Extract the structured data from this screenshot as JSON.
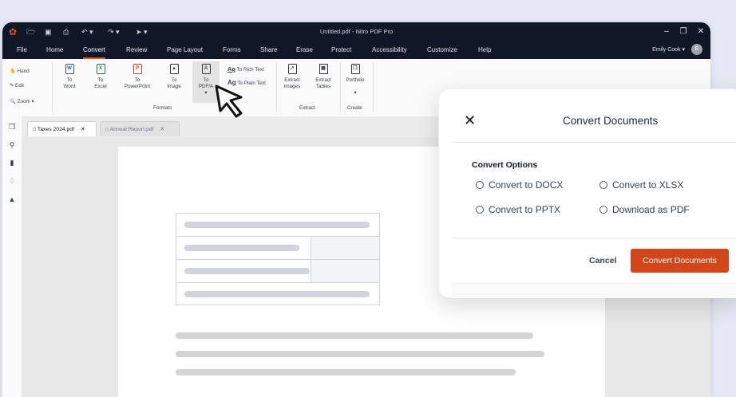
{
  "titlebar": {
    "title": "Untitled.pdf - Nitro PDF Pro",
    "user_name": "Emily Cook",
    "user_initial": "E",
    "icons": [
      "nitro-logo-icon",
      "open-folder-icon",
      "save-icon",
      "print-icon",
      "undo-icon",
      "redo-icon",
      "pointer-icon",
      "minimize-icon",
      "maximize-icon",
      "close-icon"
    ]
  },
  "menu": [
    "File",
    "Home",
    "Convert",
    "Review",
    "Page Layout",
    "Forms",
    "Share",
    "Erase",
    "Protect",
    "Accessibility",
    "Customize",
    "Help"
  ],
  "menu_active": "Convert",
  "ribbon": {
    "left_tools": [
      "Hand",
      "Edit",
      "Zoom"
    ],
    "formats": [
      "To\nWord",
      "To\nExcel",
      "To\nPowerPoint",
      "To\nImage",
      "To\nPDF/A"
    ],
    "rich_text": "To Rich Text",
    "plain_text": "To Plain Text",
    "extract": [
      "Extract\nImages",
      "Extract\nTables"
    ],
    "portfolio": "Portfolio",
    "group_formats": "Formats",
    "group_extract": "Extract",
    "group_create": "Create"
  },
  "tabs": [
    "Taxes 2024.pdf",
    "Annual Report.pdf"
  ],
  "dialog": {
    "title": "Convert Documents",
    "section": "Convert Options",
    "options": [
      "Convert to DOCX",
      "Convert to XLSX",
      "Convert to PPTX",
      "Download as PDF"
    ],
    "cancel": "Cancel",
    "confirm": "Convert Documents"
  },
  "colors": {
    "accent": "#d2461a",
    "titlebar": "#101828"
  }
}
